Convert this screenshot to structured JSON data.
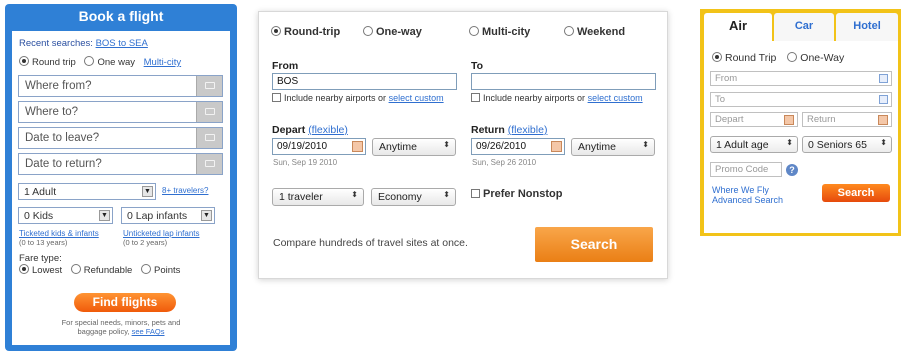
{
  "widget1": {
    "title": "Book a flight",
    "recent_label": "Recent searches:",
    "recent_link": "BOS to SEA",
    "trip_options": [
      "Round trip",
      "One way"
    ],
    "multi_city": "Multi-city",
    "fields": [
      "Where from?",
      "Where to?",
      "Date to leave?",
      "Date to return?"
    ],
    "adults_value": "1 Adult",
    "more_travelers": "8+ travelers?",
    "kids_value": "0 Kids",
    "lap_value": "0 Lap infants",
    "kids_link": "Ticketed kids & infants",
    "kids_note": "(0 to 13 years)",
    "lap_link": "Unticketed lap infants",
    "lap_note": "(0 to 2 years)",
    "fare_label": "Fare type:",
    "fare_options": [
      "Lowest",
      "Refundable",
      "Points"
    ],
    "find_button": "Find flights",
    "footer_line1": "For special needs, minors, pets and",
    "footer_line2": "baggage policy,",
    "footer_link": "see FAQs"
  },
  "widget2": {
    "trip_options": [
      "Round-trip",
      "One-way",
      "Multi-city",
      "Weekend"
    ],
    "from_label": "From",
    "from_value": "BOS",
    "to_label": "To",
    "to_value": "",
    "nearby_text": "Include nearby airports or",
    "nearby_link": "select custom",
    "depart_label": "Depart",
    "return_label": "Return",
    "flexible": "(flexible)",
    "depart_date": "09/19/2010",
    "depart_sub": "Sun, Sep 19 2010",
    "return_date": "09/26/2010",
    "return_sub": "Sun, Sep 26 2010",
    "time_value": "Anytime",
    "travelers_value": "1 traveler",
    "cabin_value": "Economy",
    "nonstop_label": "Prefer Nonstop",
    "compare_text": "Compare hundreds of travel sites at once.",
    "search_button": "Search"
  },
  "widget3": {
    "tabs": [
      "Air",
      "Car",
      "Hotel"
    ],
    "trip_options": [
      "Round Trip",
      "One-Way"
    ],
    "from_placeholder": "From",
    "to_placeholder": "To",
    "depart_placeholder": "Depart",
    "return_placeholder": "Return",
    "adults_value": "1 Adult age",
    "seniors_value": "0 Seniors 65",
    "promo_placeholder": "Promo Code",
    "help_glyph": "?",
    "link1": "Where We Fly",
    "link2": "Advanced Search",
    "search_button": "Search"
  },
  "colors": {
    "kayak_blue": "#2f80d6",
    "orange": "#f07a1c",
    "yellow": "#f2c318",
    "link": "#2f6fd0"
  },
  "icons": {
    "select_arrow": "▼",
    "updown_arrow": "⬍"
  }
}
